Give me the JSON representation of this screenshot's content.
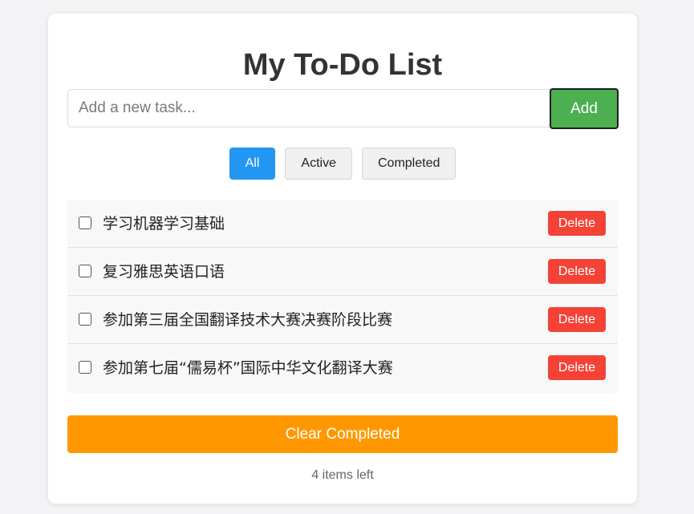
{
  "app": {
    "title": "My To-Do List"
  },
  "add_form": {
    "placeholder": "Add a new task...",
    "value": "",
    "add_label": "Add"
  },
  "filters": [
    {
      "label": "All",
      "active": true
    },
    {
      "label": "Active",
      "active": false
    },
    {
      "label": "Completed",
      "active": false
    }
  ],
  "tasks": [
    {
      "text": "学习机器学习基础",
      "completed": false,
      "delete_label": "Delete"
    },
    {
      "text": "复习雅思英语口语",
      "completed": false,
      "delete_label": "Delete"
    },
    {
      "text": "参加第三届全国翻译技术大赛决赛阶段比赛",
      "completed": false,
      "delete_label": "Delete"
    },
    {
      "text": "参加第七届“儒易杯”国际中华文化翻译大赛",
      "completed": false,
      "delete_label": "Delete"
    }
  ],
  "footer": {
    "clear_label": "Clear Completed",
    "items_left": "4 items left"
  },
  "colors": {
    "add_button": "#4caf50",
    "filter_active": "#2196f3",
    "delete_button": "#f44336",
    "clear_button": "#ff9800"
  },
  "icons": {
    "task_checkbox": "checkbox-icon"
  }
}
